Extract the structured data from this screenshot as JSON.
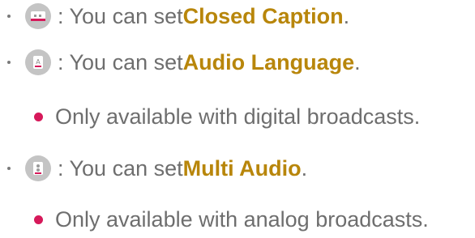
{
  "items": [
    {
      "icon": "closed-caption-icon",
      "prefix": ": You can set ",
      "bold": "Closed Caption",
      "suffix": "."
    },
    {
      "icon": "audio-language-icon",
      "prefix": ": You can set ",
      "bold": "Audio Language",
      "suffix": "."
    },
    {
      "icon": "multi-audio-icon",
      "prefix": ": You can set ",
      "bold": "Multi Audio",
      "suffix": "."
    }
  ],
  "notes": [
    "Only available with digital broadcasts.",
    "Only available with analog broadcasts."
  ],
  "colors": {
    "text": "#6e6e6e",
    "emphasis": "#b8860b",
    "note_bullet": "#d6195a",
    "icon_circle": "#c4c4c4"
  }
}
